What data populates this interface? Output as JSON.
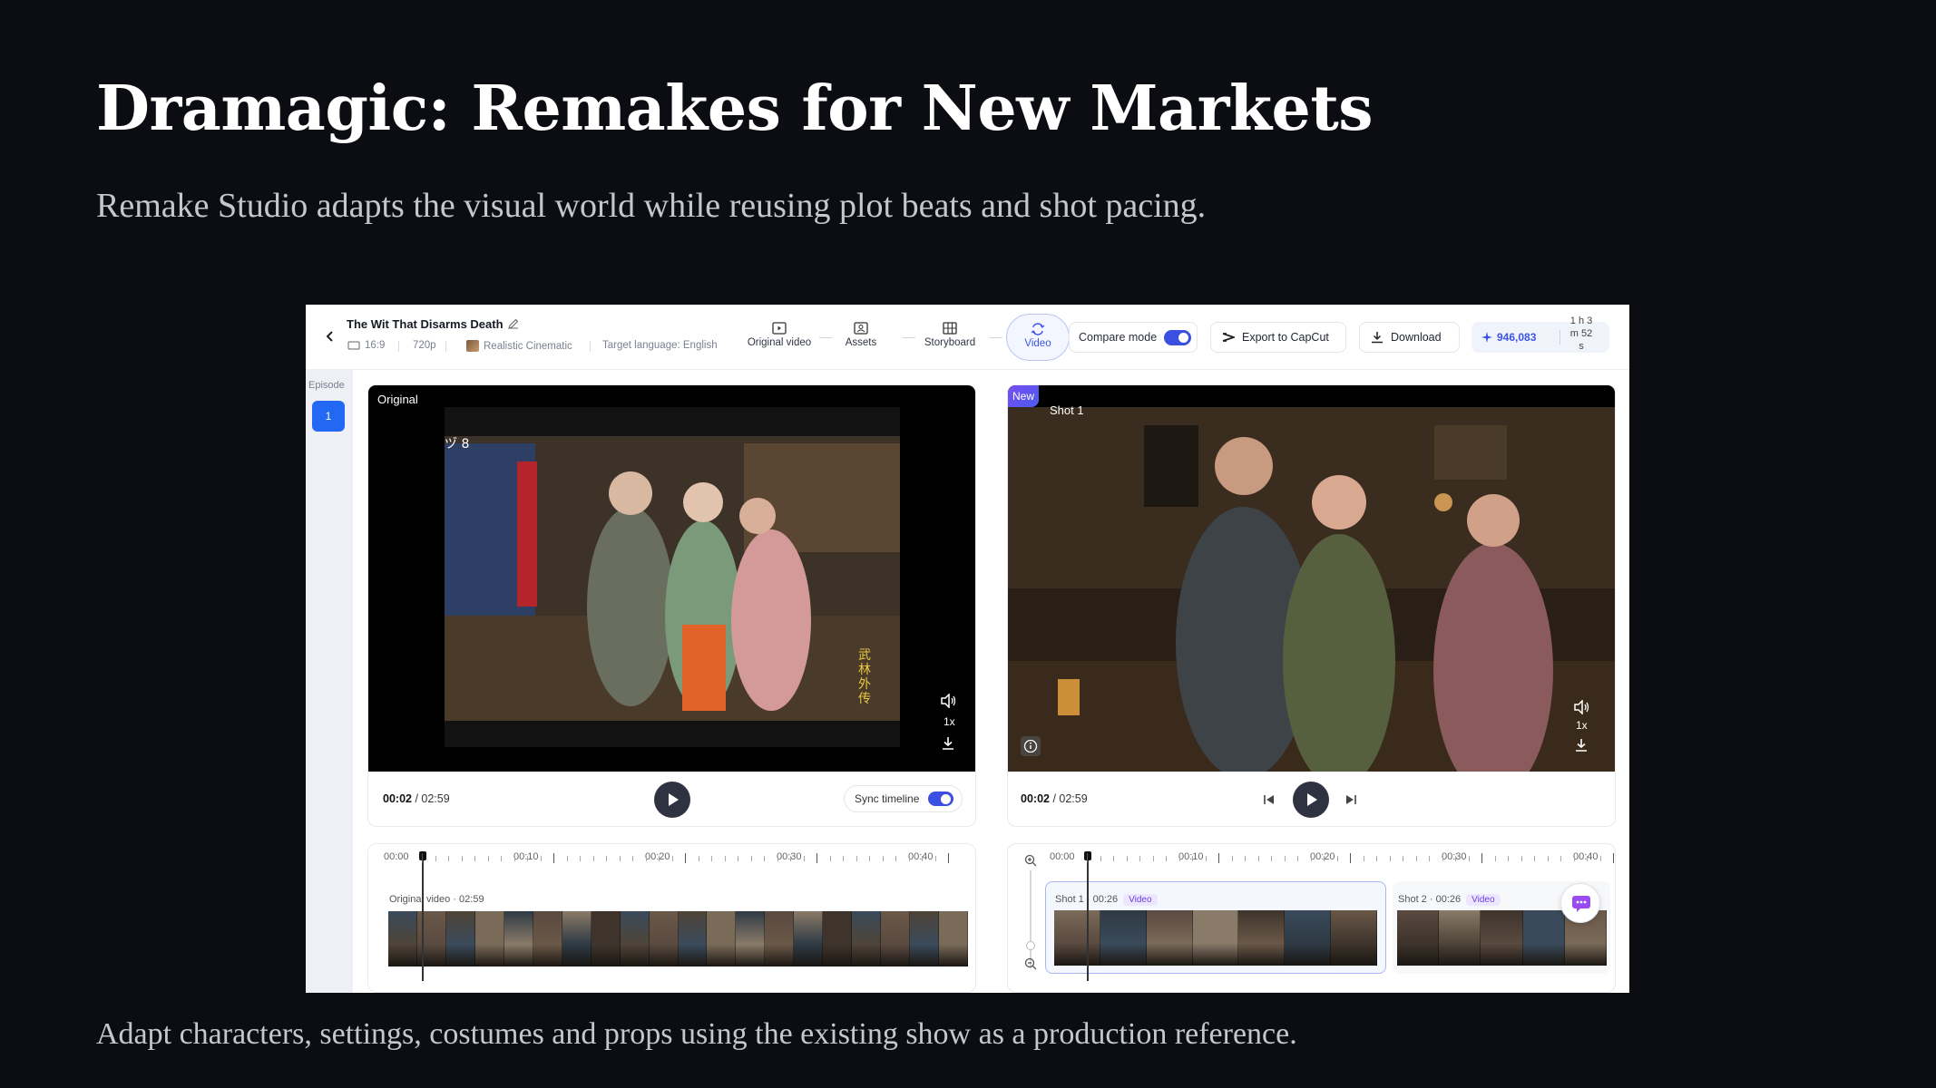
{
  "slide": {
    "title": "Dramagic: Remakes for New Markets",
    "subtitle": "Remake Studio adapts the visual world while reusing plot beats and shot pacing.",
    "footer": "Adapt characters, settings, costumes and props using the existing show as a production reference."
  },
  "app": {
    "project_title": "The Wit That Disarms Death",
    "aspect": "16:9",
    "resolution": "720p",
    "style": "Realistic Cinematic",
    "target_language": "Target language: English",
    "steps": [
      {
        "label": "Original video",
        "icon": "film-icon"
      },
      {
        "label": "Assets",
        "icon": "assets-icon"
      },
      {
        "label": "Storyboard",
        "icon": "storyboard-icon"
      },
      {
        "label": "Video",
        "icon": "video-icon"
      }
    ],
    "active_step": "Video",
    "compare_mode_label": "Compare mode",
    "compare_mode_on": true,
    "export_label": "Export to CapCut",
    "download_label": "Download",
    "credits": "946,083",
    "credit_time_lines": [
      "1 h 3",
      "m 52",
      "s"
    ],
    "accent_color": "#3b54e6"
  },
  "episodes": {
    "label": "Episode",
    "items": [
      "1"
    ]
  },
  "original_panel": {
    "label": "Original",
    "speed": "1x",
    "time_current": "00:02",
    "time_total": "02:59",
    "sync_label": "Sync timeline",
    "sync_on": true,
    "subtitle_chars": "武林外传",
    "track_label": "Original video · 02:59",
    "ruler": [
      "00:00",
      "00:10",
      "00:20",
      "00:30",
      "00:40"
    ]
  },
  "new_panel": {
    "new_badge": "New",
    "shot_label": "Shot 1",
    "speed": "1x",
    "time_current": "00:02",
    "time_total": "02:59",
    "ruler": [
      "00:00",
      "00:10",
      "00:20",
      "00:30",
      "00:40"
    ],
    "clips": [
      {
        "label": "Shot 1 · 00:26",
        "badge": "Video"
      },
      {
        "label": "Shot 2 · 00:26",
        "badge": "Video"
      }
    ]
  }
}
